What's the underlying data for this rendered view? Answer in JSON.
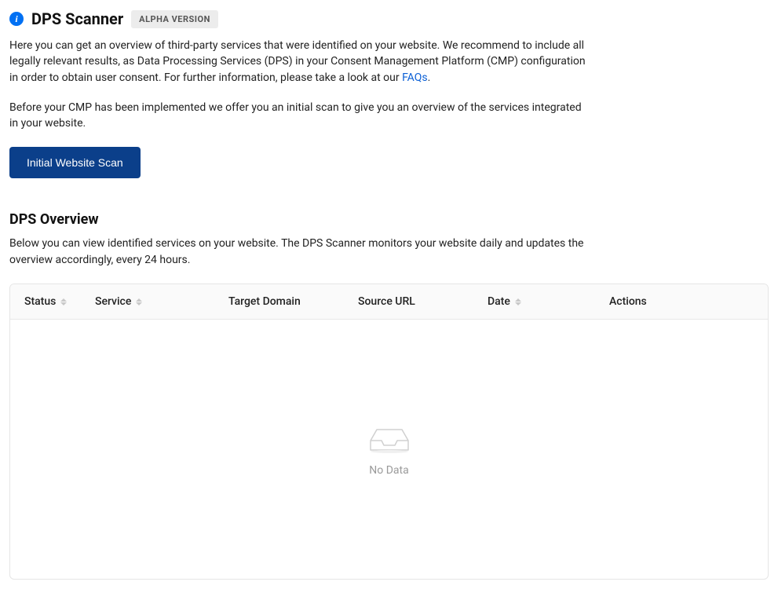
{
  "header": {
    "title": "DPS Scanner",
    "badge": "ALPHA VERSION"
  },
  "intro": {
    "text_before_link": "Here you can get an overview of third-party services that were identified on your website. We recommend to include all legally relevant results, as Data Processing Services (DPS) in your Consent Management Platform (CMP) configuration in order to obtain user consent. For further information, please take a look at our ",
    "link_text": "FAQs",
    "text_after_link": ".",
    "text2": "Before your CMP has been implemented we offer you an initial scan to give you an overview of the services integrated in your website."
  },
  "buttons": {
    "initial_scan": "Initial Website Scan"
  },
  "overview": {
    "title": "DPS Overview",
    "description": "Below you can view identified services on your website. The DPS Scanner monitors your website daily and updates the overview accordingly, every 24 hours."
  },
  "table": {
    "columns": {
      "status": "Status",
      "service": "Service",
      "target_domain": "Target Domain",
      "source_url": "Source URL",
      "date": "Date",
      "actions": "Actions"
    },
    "empty_text": "No Data",
    "rows": []
  }
}
